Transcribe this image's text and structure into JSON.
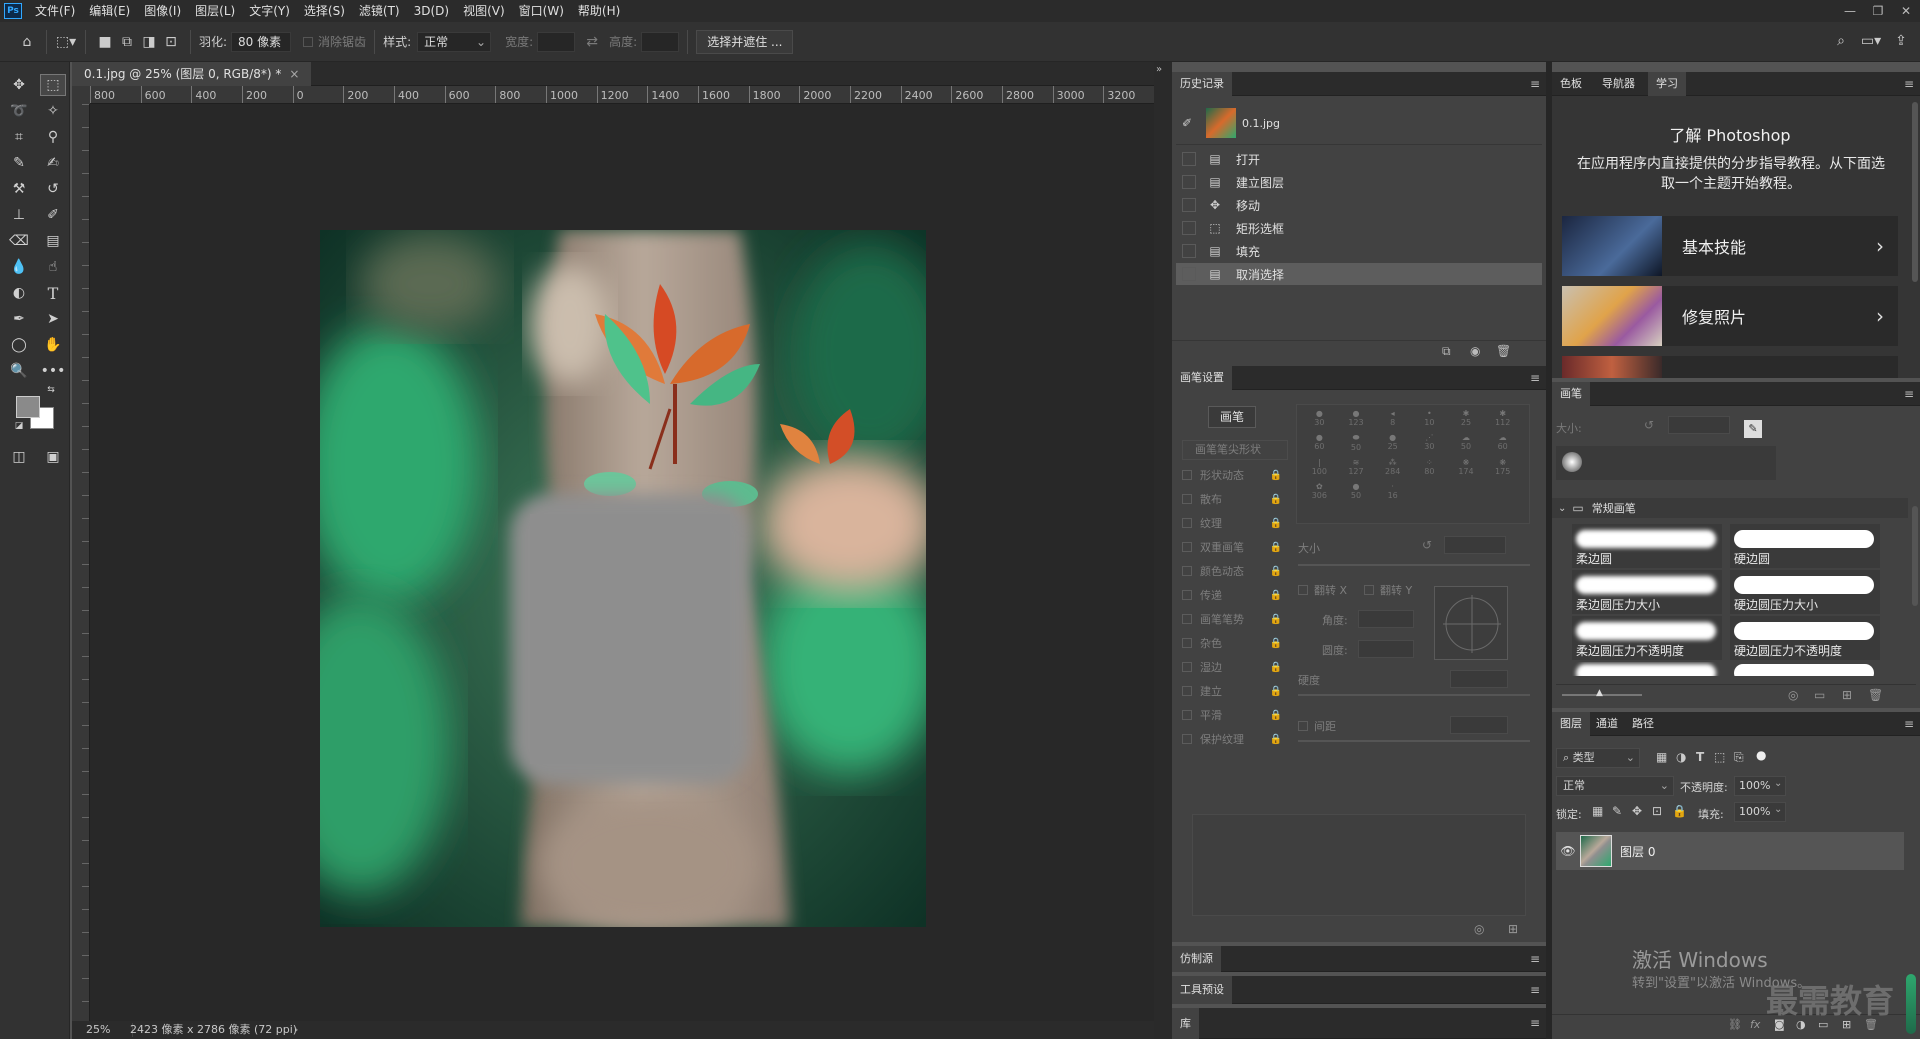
{
  "menubar": {
    "logo": "Ps",
    "items": [
      "文件(F)",
      "编辑(E)",
      "图像(I)",
      "图层(L)",
      "文字(Y)",
      "选择(S)",
      "滤镜(T)",
      "3D(D)",
      "视图(V)",
      "窗口(W)",
      "帮助(H)"
    ]
  },
  "options": {
    "feather_label": "羽化:",
    "feather_value": "80 像素",
    "antialias_label": "消除锯齿",
    "style_label": "样式:",
    "style_value": "正常",
    "width_label": "宽度:",
    "height_label": "高度:",
    "select_mask_button": "选择并遮住 ..."
  },
  "document": {
    "tab_title": "0.1.jpg @ 25% (图层 0, RGB/8*) *",
    "ruler_labels": [
      "800",
      "600",
      "400",
      "200",
      "0",
      "200",
      "400",
      "600",
      "800",
      "1000",
      "1200",
      "1400",
      "1600",
      "1800",
      "2000",
      "2200",
      "2400",
      "2600",
      "2800",
      "3000",
      "3200"
    ],
    "zoom": "25%",
    "dimensions": "2423 像素 x 2786 像素 (72 ppi)"
  },
  "history": {
    "title": "历史记录",
    "snapshot": "0.1.jpg",
    "items": [
      "打开",
      "建立图层",
      "移动",
      "矩形选框",
      "填充",
      "取消选择"
    ]
  },
  "brush_settings": {
    "title": "画笔设置",
    "brushes_button": "画笔",
    "tip_shape": "画笔笔尖形状",
    "options": [
      "形状动态",
      "散布",
      "纹理",
      "双重画笔",
      "颜色动态",
      "传递",
      "画笔笔势",
      "杂色",
      "湿边",
      "建立",
      "平滑",
      "保护纹理"
    ],
    "tip_sizes": [
      "30",
      "123",
      "8",
      "10",
      "25",
      "112",
      "60",
      "50",
      "25",
      "30",
      "50",
      "60",
      "100",
      "127",
      "284",
      "80",
      "174",
      "175",
      "306",
      "50",
      "16"
    ],
    "size_label": "大小",
    "flip_x": "翻转 X",
    "flip_y": "翻转 Y",
    "angle_label": "角度:",
    "roundness_label": "圆度:",
    "hardness_label": "硬度",
    "spacing_label": "间距"
  },
  "collapsed_panels": [
    "仿制源",
    "工具预设",
    "库"
  ],
  "learn": {
    "tabs": [
      "色板",
      "导航器",
      "学习"
    ],
    "active_tab": "学习",
    "title": "了解 Photoshop",
    "description": "在应用程序内直接提供的分步指导教程。从下面选取一个主题开始教程。",
    "cards": [
      "基本技能",
      "修复照片"
    ]
  },
  "brushes": {
    "title": "画笔",
    "size_label": "大小:",
    "group": "常规画笔",
    "items": [
      "柔边圆",
      "硬边圆",
      "柔边圆压力大小",
      "硬边圆压力大小",
      "柔边圆压力不透明度",
      "硬边圆压力不透明度"
    ]
  },
  "layers": {
    "tabs": [
      "图层",
      "通道",
      "路径"
    ],
    "filter": "类型",
    "blend_mode": "正常",
    "opacity_label": "不透明度:",
    "opacity": "100%",
    "lock_label": "锁定:",
    "fill_label": "填充:",
    "fill": "100%",
    "layer_name": "图层 0"
  },
  "overlay": {
    "activate_title": "激活 Windows",
    "activate_sub": "转到\"设置\"以激活 Windows。",
    "watermark": "最需教育"
  },
  "colors": {
    "accent": "#31a8ff",
    "panel": "#424242",
    "canvas_bg": "#282828"
  }
}
